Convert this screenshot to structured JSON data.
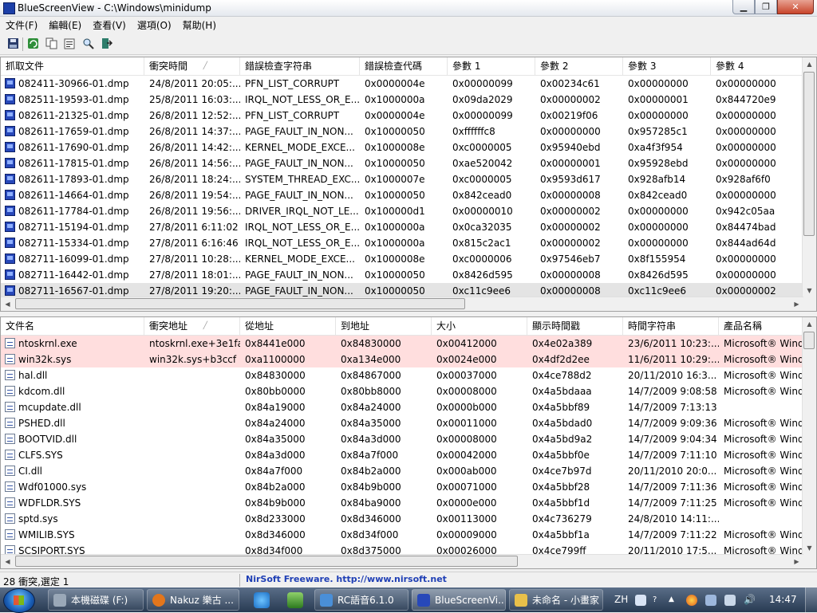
{
  "window": {
    "title": "BlueScreenView  -  C:\\Windows\\minidump"
  },
  "menu": [
    "文件(F)",
    "編輯(E)",
    "查看(V)",
    "選項(O)",
    "幫助(H)"
  ],
  "toolbar_icons": [
    "save-icon",
    "refresh-icon",
    "copy-icon",
    "properties-icon",
    "find-icon",
    "exit-icon"
  ],
  "dumps": {
    "columns": [
      "抓取文件",
      "衝突時間",
      "錯誤檢查字符串",
      "錯誤檢查代碼",
      "參數 1",
      "參數 2",
      "參數 3",
      "參數 4"
    ],
    "rows": [
      [
        "082411-30966-01.dmp",
        "24/8/2011 20:05:...",
        "PFN_LIST_CORRUPT",
        "0x0000004e",
        "0x00000099",
        "0x00234c61",
        "0x00000000",
        "0x00000000"
      ],
      [
        "082511-19593-01.dmp",
        "25/8/2011 16:03:...",
        "IRQL_NOT_LESS_OR_E...",
        "0x1000000a",
        "0x09da2029",
        "0x00000002",
        "0x00000001",
        "0x844720e9"
      ],
      [
        "082611-21325-01.dmp",
        "26/8/2011 12:52:...",
        "PFN_LIST_CORRUPT",
        "0x0000004e",
        "0x00000099",
        "0x00219f06",
        "0x00000000",
        "0x00000000"
      ],
      [
        "082611-17659-01.dmp",
        "26/8/2011 14:37:...",
        "PAGE_FAULT_IN_NON...",
        "0x10000050",
        "0xffffffc8",
        "0x00000000",
        "0x957285c1",
        "0x00000000"
      ],
      [
        "082611-17690-01.dmp",
        "26/8/2011 14:42:...",
        "KERNEL_MODE_EXCE...",
        "0x1000008e",
        "0xc0000005",
        "0x95940ebd",
        "0xa4f3f954",
        "0x00000000"
      ],
      [
        "082611-17815-01.dmp",
        "26/8/2011 14:56:...",
        "PAGE_FAULT_IN_NON...",
        "0x10000050",
        "0xae520042",
        "0x00000001",
        "0x95928ebd",
        "0x00000000"
      ],
      [
        "082611-17893-01.dmp",
        "26/8/2011 18:24:...",
        "SYSTEM_THREAD_EXC...",
        "0x1000007e",
        "0xc0000005",
        "0x9593d617",
        "0x928afb14",
        "0x928af6f0"
      ],
      [
        "082611-14664-01.dmp",
        "26/8/2011 19:54:...",
        "PAGE_FAULT_IN_NON...",
        "0x10000050",
        "0x842cead0",
        "0x00000008",
        "0x842cead0",
        "0x00000000"
      ],
      [
        "082611-17784-01.dmp",
        "26/8/2011 19:56:...",
        "DRIVER_IRQL_NOT_LE...",
        "0x100000d1",
        "0x00000010",
        "0x00000002",
        "0x00000000",
        "0x942c05aa"
      ],
      [
        "082711-15194-01.dmp",
        "27/8/2011 6:11:02",
        "IRQL_NOT_LESS_OR_E...",
        "0x1000000a",
        "0x0ca32035",
        "0x00000002",
        "0x00000000",
        "0x84474bad"
      ],
      [
        "082711-15334-01.dmp",
        "27/8/2011 6:16:46",
        "IRQL_NOT_LESS_OR_E...",
        "0x1000000a",
        "0x815c2ac1",
        "0x00000002",
        "0x00000000",
        "0x844ad64d"
      ],
      [
        "082711-16099-01.dmp",
        "27/8/2011 10:28:...",
        "KERNEL_MODE_EXCE...",
        "0x1000008e",
        "0xc0000006",
        "0x97546eb7",
        "0x8f155954",
        "0x00000000"
      ],
      [
        "082711-16442-01.dmp",
        "27/8/2011 18:01:...",
        "PAGE_FAULT_IN_NON...",
        "0x10000050",
        "0x8426d595",
        "0x00000008",
        "0x8426d595",
        "0x00000000"
      ],
      [
        "082711-16567-01.dmp",
        "27/8/2011 19:20:...",
        "PAGE_FAULT_IN_NON...",
        "0x10000050",
        "0xc11c9ee6",
        "0x00000008",
        "0xc11c9ee6",
        "0x00000002"
      ]
    ],
    "selected_index": 13
  },
  "drivers": {
    "columns": [
      "文件名",
      "衝突地址",
      "從地址",
      "到地址",
      "大小",
      "顯示時間戳",
      "時間字符串",
      "產品名稱"
    ],
    "rows": [
      [
        "ntoskrnl.exe",
        "ntoskrnl.exe+3e1fa",
        "0x8441e000",
        "0x84830000",
        "0x00412000",
        "0x4e02a389",
        "23/6/2011 10:23:...",
        "Microsoft® Wind"
      ],
      [
        "win32k.sys",
        "win32k.sys+b3ccf",
        "0xa1100000",
        "0xa134e000",
        "0x0024e000",
        "0x4df2d2ee",
        "11/6/2011 10:29:...",
        "Microsoft® Wind"
      ],
      [
        "hal.dll",
        "",
        "0x84830000",
        "0x84867000",
        "0x00037000",
        "0x4ce788d2",
        "20/11/2010 16:3...",
        "Microsoft® Wind"
      ],
      [
        "kdcom.dll",
        "",
        "0x80bb0000",
        "0x80bb8000",
        "0x00008000",
        "0x4a5bdaaa",
        "14/7/2009 9:08:58",
        "Microsoft® Wind"
      ],
      [
        "mcupdate.dll",
        "",
        "0x84a19000",
        "0x84a24000",
        "0x0000b000",
        "0x4a5bbf89",
        "14/7/2009 7:13:13",
        ""
      ],
      [
        "PSHED.dll",
        "",
        "0x84a24000",
        "0x84a35000",
        "0x00011000",
        "0x4a5bdad0",
        "14/7/2009 9:09:36",
        "Microsoft® Wind"
      ],
      [
        "BOOTVID.dll",
        "",
        "0x84a35000",
        "0x84a3d000",
        "0x00008000",
        "0x4a5bd9a2",
        "14/7/2009 9:04:34",
        "Microsoft® Wind"
      ],
      [
        "CLFS.SYS",
        "",
        "0x84a3d000",
        "0x84a7f000",
        "0x00042000",
        "0x4a5bbf0e",
        "14/7/2009 7:11:10",
        "Microsoft® Wind"
      ],
      [
        "CI.dll",
        "",
        "0x84a7f000",
        "0x84b2a000",
        "0x000ab000",
        "0x4ce7b97d",
        "20/11/2010 20:0...",
        "Microsoft® Wind"
      ],
      [
        "Wdf01000.sys",
        "",
        "0x84b2a000",
        "0x84b9b000",
        "0x00071000",
        "0x4a5bbf28",
        "14/7/2009 7:11:36",
        "Microsoft® Wind"
      ],
      [
        "WDFLDR.SYS",
        "",
        "0x84b9b000",
        "0x84ba9000",
        "0x0000e000",
        "0x4a5bbf1d",
        "14/7/2009 7:11:25",
        "Microsoft® Wind"
      ],
      [
        "sptd.sys",
        "",
        "0x8d233000",
        "0x8d346000",
        "0x00113000",
        "0x4c736279",
        "24/8/2010 14:11:...",
        ""
      ],
      [
        "WMILIB.SYS",
        "",
        "0x8d346000",
        "0x8d34f000",
        "0x00009000",
        "0x4a5bbf1a",
        "14/7/2009 7:11:22",
        "Microsoft® Wind"
      ],
      [
        "SCSIPORT.SYS",
        "",
        "0x8d34f000",
        "0x8d375000",
        "0x00026000",
        "0x4ce799ff",
        "20/11/2010 17:5...",
        "Microsoft® Wind"
      ]
    ],
    "highlighted_indices": [
      0,
      1
    ]
  },
  "status": {
    "count": "28 衝突,選定 1",
    "credit": "NirSoft Freeware.  http://www.nirsoft.net"
  },
  "taskbar": {
    "buttons": [
      {
        "label": "本機磁碟 (F:)",
        "icon": "drive-icon",
        "color": "#9aa8b8"
      },
      {
        "label": "Nakuz 樂古 ...",
        "icon": "firefox-icon",
        "color": "#e3761c"
      },
      {
        "label": "RC語音6.1.0",
        "icon": "rc-icon",
        "color": "#4a8fd8"
      },
      {
        "label": "BlueScreenVi...",
        "icon": "bluescreenview-icon",
        "color": "#2748b9",
        "active": true
      },
      {
        "label": "未命名 - 小畫家",
        "icon": "paint-icon",
        "color": "#e8c04a"
      }
    ],
    "quicklaunch": [
      "internet-explorer-icon",
      "network-icon"
    ],
    "language": "ZH",
    "clock": "14:47"
  }
}
